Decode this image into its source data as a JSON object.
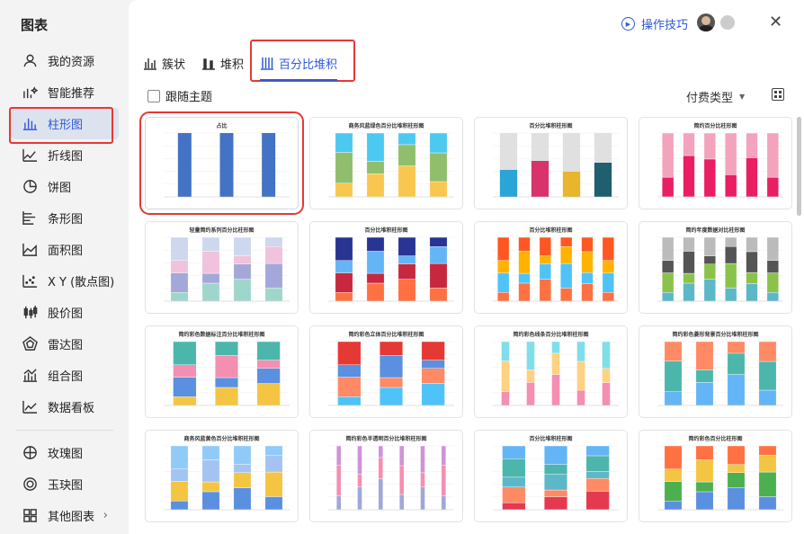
{
  "sidebar": {
    "title": "图表",
    "items": [
      {
        "label": "我的资源",
        "icon": "user-icon"
      },
      {
        "label": "智能推荐",
        "icon": "sparkle-chart-icon"
      },
      {
        "label": "柱形图",
        "icon": "bar-chart-icon",
        "active": true
      },
      {
        "label": "折线图",
        "icon": "line-chart-icon"
      },
      {
        "label": "饼图",
        "icon": "pie-chart-icon"
      },
      {
        "label": "条形图",
        "icon": "horizontal-bar-icon"
      },
      {
        "label": "面积图",
        "icon": "area-chart-icon"
      },
      {
        "label": "X Y (散点图)",
        "icon": "scatter-icon"
      },
      {
        "label": "股价图",
        "icon": "stock-icon"
      },
      {
        "label": "雷达图",
        "icon": "radar-icon"
      },
      {
        "label": "组合图",
        "icon": "combo-icon"
      },
      {
        "label": "数据看板",
        "icon": "dashboard-icon"
      },
      {
        "label": "玫瑰图",
        "icon": "rose-icon"
      },
      {
        "label": "玉玦图",
        "icon": "ring-icon"
      },
      {
        "label": "其他图表",
        "icon": "more-icon"
      }
    ]
  },
  "header": {
    "help_label": "操作技巧",
    "close_glyph": "✕"
  },
  "tabs": [
    {
      "label": "簇状"
    },
    {
      "label": "堆积"
    },
    {
      "label": "百分比堆积",
      "active": true
    }
  ],
  "toolbar": {
    "follow_theme_label": "跟随主题",
    "fee_type_label": "付费类型",
    "caret": "▼"
  },
  "colors": {
    "accent": "#2f58d9",
    "highlight": "#e53935"
  },
  "cards": [
    {
      "title": "占比",
      "style": "blue",
      "selected": true
    },
    {
      "title": "商务风蓝绿色百分比堆积柱形图",
      "style": "cylinders"
    },
    {
      "title": "百分比堆积柱形图",
      "style": "3d"
    },
    {
      "title": "简约百分比柱形图",
      "style": "pink"
    },
    {
      "title": "轻量简约系列百分比柱形图",
      "style": "soft"
    },
    {
      "title": "百分比堆积柱形图",
      "style": "dark"
    },
    {
      "title": "百分比堆积柱形图",
      "style": "warm"
    },
    {
      "title": "简约年度数据对比柱形图",
      "style": "grey"
    },
    {
      "title": "简约彩色数据标注百分比堆积柱形图",
      "style": "pastel"
    },
    {
      "title": "简约彩色立体百分比堆积柱形图",
      "style": "colorful"
    },
    {
      "title": "简约彩色线条百分比堆积柱形图",
      "style": "stripes"
    },
    {
      "title": "简约彩色菱形背景百分比堆积柱形图",
      "style": "diamond"
    },
    {
      "title": "商务风蓝黄色百分比堆积柱形图",
      "style": "blueyellow"
    },
    {
      "title": "简约彩色半透明百分比堆积柱形图",
      "style": "thin"
    },
    {
      "title": "百分比堆积柱形图",
      "style": "teal"
    },
    {
      "title": "简约彩色百分比柱形图",
      "style": "rainbow"
    }
  ]
}
